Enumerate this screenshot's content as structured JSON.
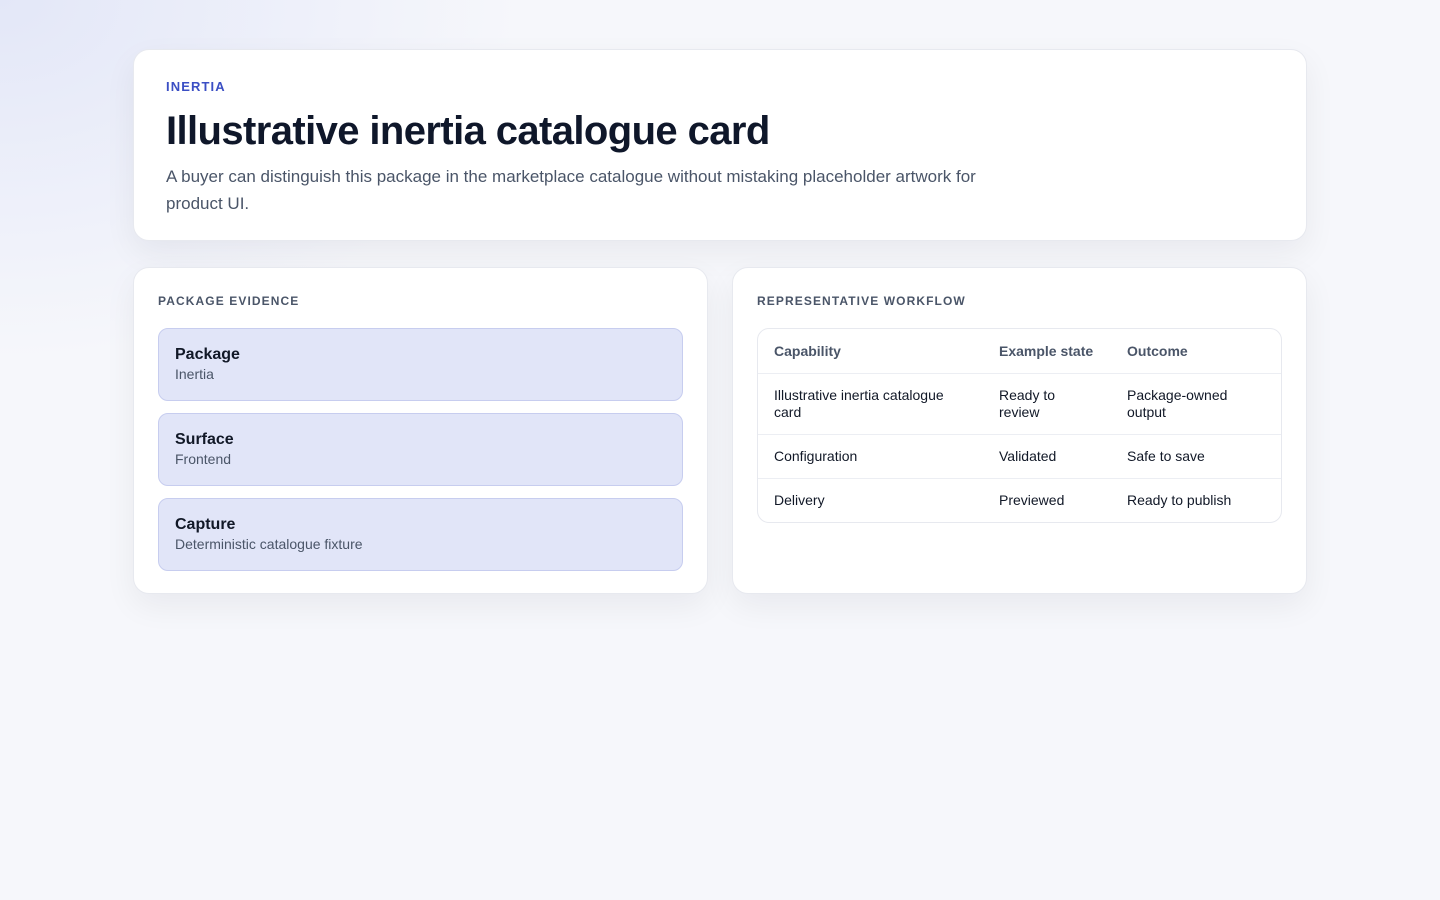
{
  "hero": {
    "eyebrow": "INERTIA",
    "title": "Illustrative inertia catalogue card",
    "description": "A buyer can distinguish this package in the marketplace catalogue without mistaking placeholder artwork for product UI."
  },
  "evidence": {
    "heading": "PACKAGE EVIDENCE",
    "items": [
      {
        "title": "Package",
        "value": "Inertia"
      },
      {
        "title": "Surface",
        "value": "Frontend"
      },
      {
        "title": "Capture",
        "value": "Deterministic catalogue fixture"
      }
    ]
  },
  "workflow": {
    "heading": "REPRESENTATIVE WORKFLOW",
    "columns": [
      "Capability",
      "Example state",
      "Outcome"
    ],
    "rows": [
      [
        "Illustrative inertia catalogue card",
        "Ready to review",
        "Package-owned output"
      ],
      [
        "Configuration",
        "Validated",
        "Safe to save"
      ],
      [
        "Delivery",
        "Previewed",
        "Ready to publish"
      ]
    ]
  }
}
